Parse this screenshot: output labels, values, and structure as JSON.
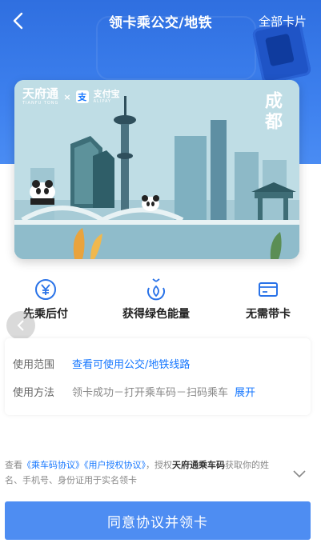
{
  "header": {
    "title": "领卡乘公交/地铁",
    "right_link": "全部卡片",
    "back_icon": "chevron-left-icon"
  },
  "card": {
    "brand_tianfu": "天府通",
    "brand_tianfu_en": "TIANFU TONG",
    "brand_sep": "×",
    "brand_alipay": "支付宝",
    "brand_alipay_en": "ALIPAY",
    "brand_alipay_mark": "支",
    "city": "成都"
  },
  "features": [
    {
      "icon": "yuan-circle-icon",
      "label": "先乘后付"
    },
    {
      "icon": "leaf-energy-icon",
      "label": "获得绿色能量"
    },
    {
      "icon": "card-icon",
      "label": "无需带卡"
    }
  ],
  "info": {
    "scope_label": "使用范围",
    "scope_link": "查看可使用公交/地铁线路",
    "method_label": "使用方法",
    "method_value": "领卡成功－打开乘车码－扫码乘车",
    "method_expand": "展开"
  },
  "agreement": {
    "prefix": "查看",
    "link1": "《乘车码协议》",
    "link2": "《用户授权协议》",
    "middle": "，授权",
    "app_name": "天府通乘车码",
    "suffix": "获取你的姓名、手机号、身份证用于实名领卡"
  },
  "primary_button": "同意协议并领卡",
  "colors": {
    "accent": "#1677ff",
    "hero_blue": "#2f6fe0",
    "button_blue": "#4e8df2"
  }
}
